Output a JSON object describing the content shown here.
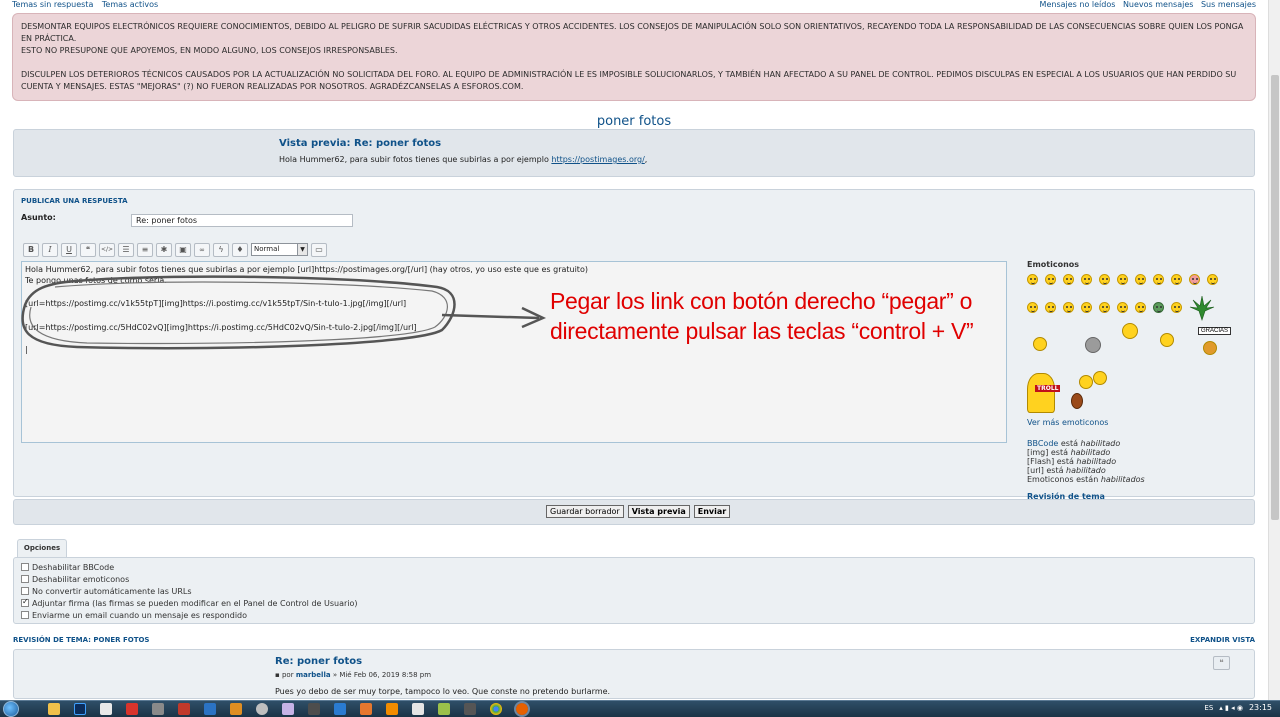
{
  "top_nav": {
    "left": [
      "Temas sin respuesta",
      "Temas activos"
    ],
    "right": [
      "Mensajes no leídos",
      "Nuevos mensajes",
      "Sus mensajes"
    ]
  },
  "notice": {
    "line1": "DESMONTAR EQUIPOS ELECTRÓNICOS REQUIERE CONOCIMIENTOS, DEBIDO AL PELIGRO DE SUFRIR SACUDIDAS ELÉCTRICAS Y OTROS ACCIDENTES. LOS CONSEJOS DE MANIPULACIÓN SOLO SON ORIENTATIVOS, RECAYENDO TODA LA RESPONSABILIDAD DE LAS CONSECUENCIAS SOBRE QUIEN LOS PONGA EN PRÁCTICA.",
    "line2": "ESTO NO PRESUPONE QUE APOYEMOS, EN MODO ALGUNO, LOS CONSEJOS IRRESPONSABLES.",
    "line3": "DISCULPEN LOS DETERIOROS TÉCNICOS CAUSADOS POR LA ACTUALIZACIÓN NO SOLICITADA DEL FORO. AL EQUIPO DE ADMINISTRACIÓN LE ES IMPOSIBLE SOLUCIONARLOS, Y TAMBIÉN HAN AFECTADO A SU PANEL DE CONTROL. PEDIMOS DISCULPAS EN ESPECIAL A LOS USUARIOS QUE HAN PERDIDO SU CUENTA Y MENSAJES. ESTAS \"MEJORAS\" (?) NO FUERON REALIZADAS POR NOSOTROS. AGRADÉZCANSELAS A ESFOROS.COM."
  },
  "topic_title": "poner fotos",
  "preview": {
    "title": "Vista previa: Re: poner fotos",
    "text": "Hola Hummer62, para subir fotos tienes que subirlas a por ejemplo ",
    "link": "https://postimages.org/",
    "after": ","
  },
  "reply": {
    "header": "PUBLICAR UNA RESPUESTA",
    "subject_label": "Asunto:",
    "subject_value": "Re: poner fotos",
    "toolbar": {
      "bold": "B",
      "italic": "I",
      "underline": "U",
      "quote": "❝",
      "code": "</>",
      "list": "☰",
      "list_num": "≡",
      "list_item": "✱",
      "img": "▣",
      "url": "🔗",
      "flash": "ϟ",
      "color": "♦",
      "size_value": "Normal",
      "preview": "▭"
    },
    "editor_lines": [
      "Hola Hummer62, para subir fotos tienes que subirlas a por ejemplo [url]https://postimages.org/[/url] (hay otros, yo uso este que es gratuito)",
      "Te pongo unas fotos de como sería.",
      "",
      "[url=https://postimg.cc/v1k55tpT][img]https://i.postimg.cc/v1k55tpT/Sin-t-tulo-1.jpg[/img][/url]",
      "",
      "[url=https://postimg.cc/5HdC02vQ][img]https://i.postimg.cc/5HdC02vQ/Sin-t-tulo-2.jpg[/img][/url]",
      "",
      "|"
    ],
    "annotation": "Pegar los link con botón derecho “pegar” o directamente pulsar las teclas “control + V”"
  },
  "sidebar": {
    "emoticons_label": "Emoticonos",
    "gracias": "GRACIAS",
    "troll": "TROLL",
    "more_link": "Ver más emoticonos",
    "status": {
      "bbcode_link": "BBCode",
      "bbcode_rest": " está ",
      "bbcode_state": "habilitado",
      "img": "[img] está ",
      "img_state": "habilitado",
      "flash": "[Flash] está ",
      "flash_state": "habilitado",
      "url": "[url] está ",
      "url_state": "habilitado",
      "emo": "Emoticonos están ",
      "emo_state": "habilitados"
    },
    "revision_link": "Revisión de tema"
  },
  "buttons": {
    "draft": "Guardar borrador",
    "preview": "Vista previa",
    "submit": "Enviar"
  },
  "options": {
    "tab": "Opciones",
    "items": [
      {
        "label": "Deshabilitar BBCode",
        "checked": false
      },
      {
        "label": "Deshabilitar emoticonos",
        "checked": false
      },
      {
        "label": "No convertir automáticamente las URLs",
        "checked": false
      },
      {
        "label": "Adjuntar firma (las firmas se pueden modificar en el Panel de Control de Usuario)",
        "checked": true
      },
      {
        "label": "Enviarme un email cuando un mensaje es respondido",
        "checked": false
      }
    ]
  },
  "review": {
    "header": "REVISIÓN DE TEMA: PONER FOTOS",
    "expand": "EXPANDIR VISTA",
    "post_title": "Re: poner fotos",
    "meta_prefix": "por ",
    "author": "marbella",
    "date": " » Mié Feb 06, 2019 8:58 pm",
    "text": "Pues yo debo de ser muy torpe, tampoco lo veo. Que conste no pretendo burlarme."
  },
  "taskbar": {
    "lang": "ES",
    "time": "23:15"
  },
  "colors": {
    "link": "#105289",
    "notice_bg": "#ecd5d8",
    "panel_bg": "#ecf0f3",
    "annotation": "#e00000"
  }
}
